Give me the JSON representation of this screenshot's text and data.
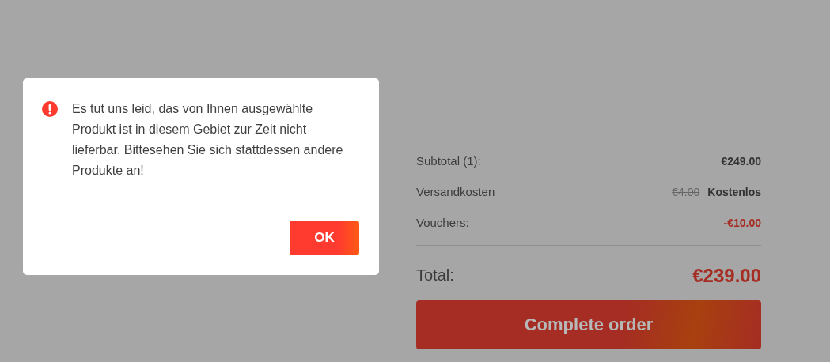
{
  "dialog": {
    "message": "Es tut uns leid, das von Ihnen ausgewählte Produkt ist in diesem Gebiet zur Zeit nicht lieferbar. Bittesehen Sie sich stattdessen andere Produkte an!",
    "button": "OK"
  },
  "summary": {
    "rows": [
      {
        "kind": "plain",
        "label": "Subtotal (1):",
        "value": "€249.00"
      },
      {
        "kind": "shipping",
        "label": "Versandkosten",
        "original": "€4.00",
        "value": "Kostenlos"
      },
      {
        "kind": "discount",
        "label": "Vouchers:",
        "value": "-€10.00"
      }
    ],
    "total": {
      "label": "Total:",
      "value": "€239.00"
    },
    "button": "Complete order"
  }
}
